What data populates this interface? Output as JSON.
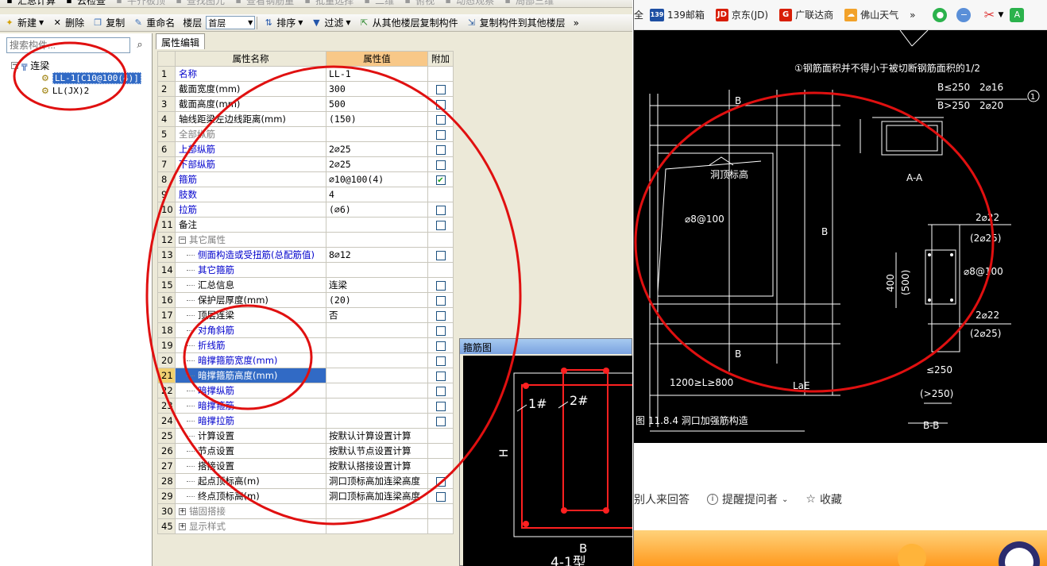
{
  "toolbar1": {
    "items": [
      {
        "label": "汇总计算",
        "icon": "sum-icon"
      },
      {
        "label": "云检查",
        "icon": "cloud-check-icon"
      },
      {
        "label": "平齐板顶",
        "icon": "align-icon"
      },
      {
        "label": "查找图元",
        "icon": "find-icon"
      },
      {
        "label": "查看钢筋量",
        "icon": "rebar-icon"
      },
      {
        "label": "批量选择",
        "icon": "batch-select-icon"
      },
      {
        "label": "二维",
        "icon": "2d-icon"
      },
      {
        "label": "俯视",
        "icon": "top-view-icon"
      },
      {
        "label": "动态观察",
        "icon": "orbit-icon"
      },
      {
        "label": "局部三维",
        "icon": "local-3d-icon"
      }
    ]
  },
  "toolbar2": {
    "new_label": "新建",
    "delete_label": "删除",
    "copy_label": "复制",
    "rename_label": "重命名",
    "floor_label": "楼层",
    "floor_value": "首层",
    "sort_label": "排序",
    "filter_label": "过滤",
    "copy_from_label": "从其他楼层复制构件",
    "copy_to_label": "复制构件到其他楼层",
    "more_label": "»"
  },
  "left": {
    "search_placeholder": "搜索构件...",
    "tree_root": "连梁",
    "tree_items": [
      "LL-1[C10@100(4)]",
      "LL(JX)2"
    ]
  },
  "props": {
    "tab_label": "属性编辑",
    "header_name": "属性名称",
    "header_value": "属性值",
    "header_extra": "附加",
    "rows": [
      {
        "n": "1",
        "name": "名称",
        "value": "LL-1",
        "cls": "blue",
        "chk": "none"
      },
      {
        "n": "2",
        "name": "截面宽度(mm)",
        "value": "300",
        "cls": "",
        "chk": "off"
      },
      {
        "n": "3",
        "name": "截面高度(mm)",
        "value": "500",
        "cls": "",
        "chk": "off"
      },
      {
        "n": "4",
        "name": "轴线距梁左边线距离(mm)",
        "value": "(150)",
        "cls": "",
        "chk": "off"
      },
      {
        "n": "5",
        "name": "全部纵筋",
        "value": "",
        "cls": "gray",
        "chk": "off"
      },
      {
        "n": "6",
        "name": "上部纵筋",
        "value": "2⌀25",
        "cls": "blue",
        "chk": "off"
      },
      {
        "n": "7",
        "name": "下部纵筋",
        "value": "2⌀25",
        "cls": "blue",
        "chk": "off"
      },
      {
        "n": "8",
        "name": "箍筋",
        "value": "⌀10@100(4)",
        "cls": "blue",
        "chk": "on"
      },
      {
        "n": "9",
        "name": "肢数",
        "value": "4",
        "cls": "blue",
        "chk": "none"
      },
      {
        "n": "10",
        "name": "拉筋",
        "value": "(⌀6)",
        "cls": "blue",
        "chk": "off"
      },
      {
        "n": "11",
        "name": "备注",
        "value": "",
        "cls": "",
        "chk": "off"
      },
      {
        "n": "12",
        "name": "其它属性",
        "value": "",
        "cls": "gray",
        "chk": "none",
        "group": "−"
      },
      {
        "n": "13",
        "name": "侧面构造或受扭筋(总配筋值)",
        "value": "8⌀12",
        "cls": "blue ind",
        "chk": "off"
      },
      {
        "n": "14",
        "name": "其它箍筋",
        "value": "",
        "cls": "blue ind",
        "chk": "none"
      },
      {
        "n": "15",
        "name": "汇总信息",
        "value": "连梁",
        "cls": "ind",
        "chk": "off"
      },
      {
        "n": "16",
        "name": "保护层厚度(mm)",
        "value": "(20)",
        "cls": "ind",
        "chk": "off"
      },
      {
        "n": "17",
        "name": "顶层连梁",
        "value": "否",
        "cls": "ind",
        "chk": "off"
      },
      {
        "n": "18",
        "name": "对角斜筋",
        "value": "",
        "cls": "blue ind",
        "chk": "off"
      },
      {
        "n": "19",
        "name": "折线筋",
        "value": "",
        "cls": "blue ind",
        "chk": "off"
      },
      {
        "n": "20",
        "name": "暗撑箍筋宽度(mm)",
        "value": "",
        "cls": "blue ind",
        "chk": "off"
      },
      {
        "n": "21",
        "name": "暗撑箍筋高度(mm)",
        "value": "",
        "cls": "ind hl",
        "chk": "off",
        "current": true
      },
      {
        "n": "22",
        "name": "暗撑纵筋",
        "value": "",
        "cls": "blue ind",
        "chk": "off"
      },
      {
        "n": "23",
        "name": "暗撑箍筋",
        "value": "",
        "cls": "blue ind",
        "chk": "off"
      },
      {
        "n": "24",
        "name": "暗撑拉筋",
        "value": "",
        "cls": "blue ind",
        "chk": "off"
      },
      {
        "n": "25",
        "name": "计算设置",
        "value": "按默认计算设置计算",
        "cls": "ind",
        "chk": "none"
      },
      {
        "n": "26",
        "name": "节点设置",
        "value": "按默认节点设置计算",
        "cls": "ind",
        "chk": "none"
      },
      {
        "n": "27",
        "name": "搭接设置",
        "value": "按默认搭接设置计算",
        "cls": "ind",
        "chk": "none"
      },
      {
        "n": "28",
        "name": "起点顶标高(m)",
        "value": "洞口顶标高加连梁高度",
        "cls": "ind",
        "chk": "off"
      },
      {
        "n": "29",
        "name": "终点顶标高(m)",
        "value": "洞口顶标高加连梁高度",
        "cls": "ind",
        "chk": "off"
      },
      {
        "n": "30",
        "name": "锚固搭接",
        "value": "",
        "cls": "gray",
        "chk": "none",
        "group": "+"
      },
      {
        "n": "45",
        "name": "显示样式",
        "value": "",
        "cls": "gray",
        "chk": "none",
        "group": "+"
      }
    ]
  },
  "stirrup": {
    "title": "箍筋图",
    "label_1": "1#",
    "label_2": "2#",
    "label_h": "H",
    "label_b": "B",
    "type_label": "4-1型"
  },
  "browser": {
    "bookmarks": [
      {
        "label": "139邮箱",
        "badge": "139",
        "color": "#1e4fa3"
      },
      {
        "label": "京东(JD)",
        "badge": "JD",
        "color": "#d81e06"
      },
      {
        "label": "广联达商",
        "badge": "G",
        "color": "#d81e06"
      },
      {
        "label": "佛山天气",
        "badge": "☁",
        "color": "#f2a22a"
      }
    ],
    "bookmark_more": "»",
    "qa_items": [
      {
        "label": "别人来回答",
        "icon": "invite-icon"
      },
      {
        "label": "提醒提问者",
        "icon": "info-icon"
      },
      {
        "label": "收藏",
        "icon": "star-icon"
      }
    ]
  },
  "cad": {
    "note": "①钢筋面积并不得小于被切断钢筋面积的1/2",
    "b_le_250": "B≤250",
    "b_le_250_bar": "2⌀16",
    "b_gt_250": "B>250",
    "b_gt_250_bar": "2⌀20",
    "circle_1": "1",
    "label_b": "B",
    "hole_top": "洞顶标高",
    "stirrup_8": "⌀8@100",
    "section_aa": "A-A",
    "bar_2_22_top": "2⌀22",
    "bar_2_25_top": "(2⌀25)",
    "dim_400": "400",
    "dim_500": "(500)",
    "stirrup_8b": "⌀8@100",
    "bar_2_22_bot": "2⌀22",
    "bar_2_25_bot": "(2⌀25)",
    "dim_le_250": "≤250",
    "dim_gt_250": "(>250)",
    "span_text": "1200≥L≥800",
    "lae": "LaE",
    "fig_caption": "图 11.8.4  洞口加强筋构造",
    "section_bb": "B-B"
  }
}
